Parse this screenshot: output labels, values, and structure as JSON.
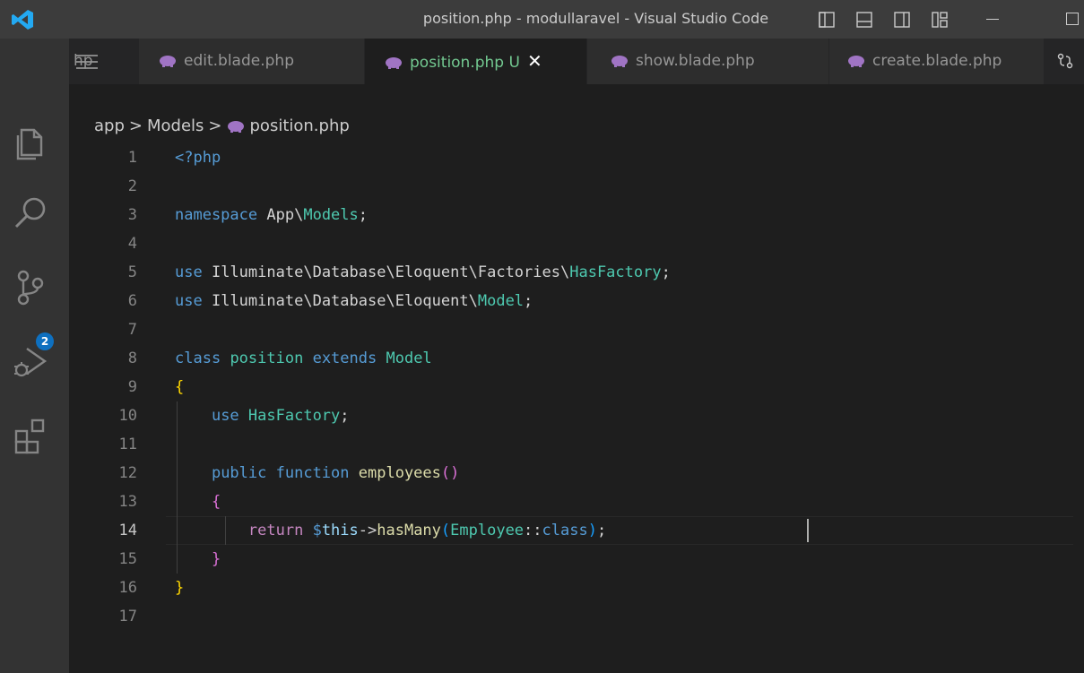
{
  "window": {
    "title": "position.php - modullaravel - Visual Studio Code"
  },
  "activity_bar": {
    "scm_badge": "2"
  },
  "tabs": [
    {
      "label": "hp",
      "active": false
    },
    {
      "label": "edit.blade.php",
      "active": false
    },
    {
      "label": "position.php U",
      "active": true
    },
    {
      "label": "show.blade.php",
      "active": false
    },
    {
      "label": "create.blade.php",
      "active": false
    }
  ],
  "tab_close_glyph": "✕",
  "breadcrumb": {
    "parts": [
      "app",
      "Models",
      "position.php"
    ],
    "separator": ">"
  },
  "editor": {
    "active_line": 14,
    "line_numbers": [
      "1",
      "2",
      "3",
      "4",
      "5",
      "6",
      "7",
      "8",
      "9",
      "10",
      "11",
      "12",
      "13",
      "14",
      "15",
      "16",
      "17"
    ],
    "lines": [
      "<?php",
      "",
      "namespace App\\Models;",
      "",
      "use Illuminate\\Database\\Eloquent\\Factories\\HasFactory;",
      "use Illuminate\\Database\\Eloquent\\Model;",
      "",
      "class position extends Model",
      "{",
      "    use HasFactory;",
      "",
      "    public function employees()",
      "    {",
      "        return $this->hasMany(Employee::class);",
      "    }",
      "}",
      ""
    ]
  },
  "colors": {
    "titlebar": "#3c3c3c",
    "activity_bar": "#333333",
    "editor_bg": "#1e1e1e",
    "tab_modified": "#73c991",
    "keyword": "#569cd6",
    "type": "#4ec9b0",
    "function": "#dcdcaa",
    "variable": "#9cdcfe",
    "control": "#c586c0",
    "badge": "#0e70c0",
    "php_icon": "#a074c4"
  },
  "icons": [
    "vscode-logo-icon",
    "layout-sidebar-icon",
    "layout-panel-icon",
    "layout-split-icon",
    "customize-layout-icon",
    "minimize-icon",
    "maximize-icon",
    "explorer-icon",
    "search-icon",
    "source-control-icon",
    "run-debug-icon",
    "extensions-icon",
    "menu-icon",
    "php-elephant-icon",
    "close-icon",
    "compare-changes-icon"
  ]
}
